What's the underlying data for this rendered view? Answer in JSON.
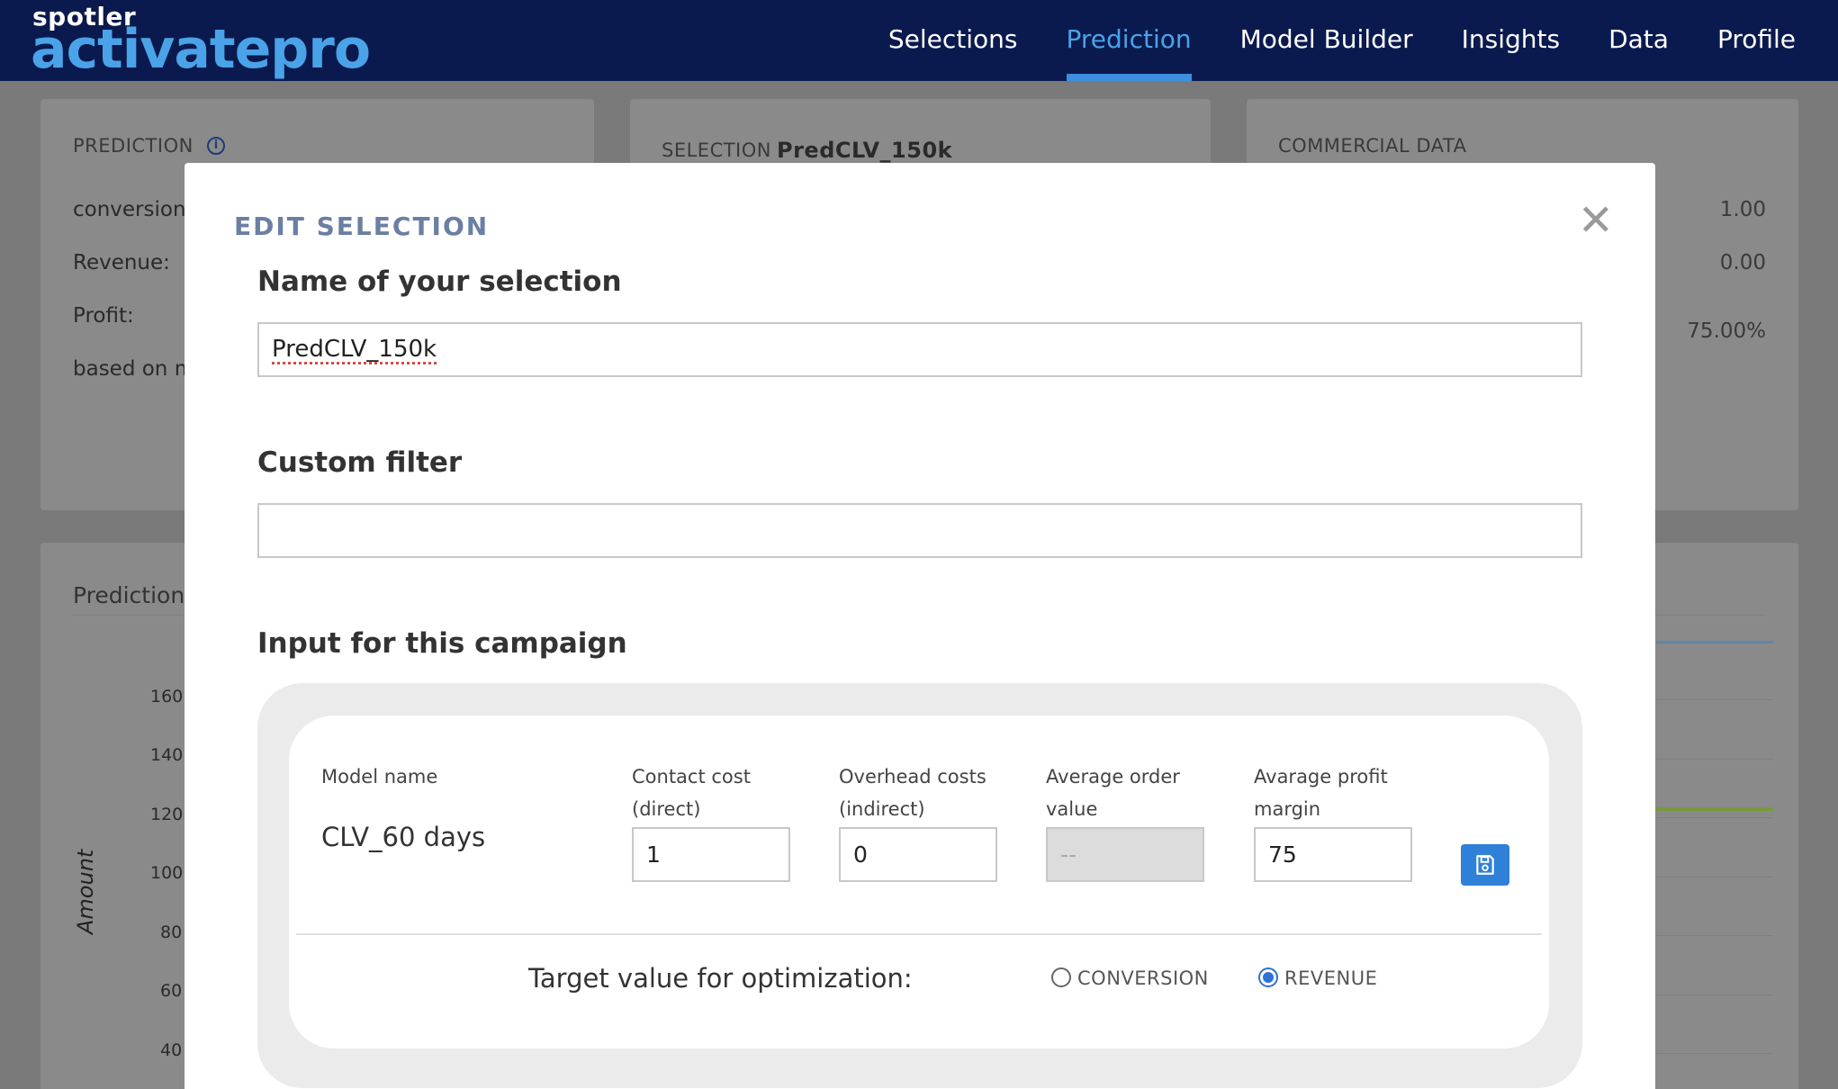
{
  "brand": {
    "small": "spotler",
    "big": "activatepro"
  },
  "nav": {
    "items": [
      {
        "label": "Selections",
        "active": false
      },
      {
        "label": "Prediction",
        "active": true
      },
      {
        "label": "Model Builder",
        "active": false
      },
      {
        "label": "Insights",
        "active": false
      },
      {
        "label": "Data",
        "active": false
      },
      {
        "label": "Profile",
        "active": false
      }
    ]
  },
  "background": {
    "prediction_card": {
      "title": "PREDICTION",
      "rows": [
        "conversion",
        "Revenue:",
        "Profit:",
        "based on m"
      ]
    },
    "selection_card": {
      "label": "SELECTION",
      "value": "PredCLV_150k"
    },
    "commercial_card": {
      "title": "COMMERCIAL DATA",
      "values": [
        "1.00",
        "0.00",
        "75.00%"
      ]
    },
    "chart_card": {
      "title": "Prediction",
      "ylabel": "Amount",
      "ticks": [
        "160",
        "140",
        "120",
        "100",
        "80",
        "60",
        "40"
      ]
    }
  },
  "modal": {
    "title": "EDIT SELECTION",
    "close_icon": "close-icon",
    "name_heading": "Name of your selection",
    "name_value": "PredCLV_150k",
    "filter_heading": "Custom filter",
    "filter_value": "",
    "campaign_heading": "Input for this campaign",
    "campaign": {
      "model_name_label": "Model name",
      "model_name_value": "CLV_60 days",
      "contact_cost_label_1": "Contact cost",
      "contact_cost_label_2": "(direct)",
      "contact_cost_value": "1",
      "overhead_label_1": "Overhead costs",
      "overhead_label_2": "(indirect)",
      "overhead_value": "0",
      "avg_order_label_1": "Average order",
      "avg_order_label_2": "value",
      "avg_order_value": "--",
      "profit_margin_label_1": "Avarage profit",
      "profit_margin_label_2": "margin",
      "profit_margin_value": "75",
      "save_icon": "save-icon"
    },
    "target": {
      "label": "Target value for optimization:",
      "options": [
        {
          "label": "CONVERSION",
          "selected": false
        },
        {
          "label": "REVENUE",
          "selected": true
        }
      ]
    }
  },
  "colors": {
    "nav_bg": "#0b1a4e",
    "accent": "#4aa3e8",
    "button": "#2f80d8",
    "modal_title": "#6b7fa3"
  }
}
